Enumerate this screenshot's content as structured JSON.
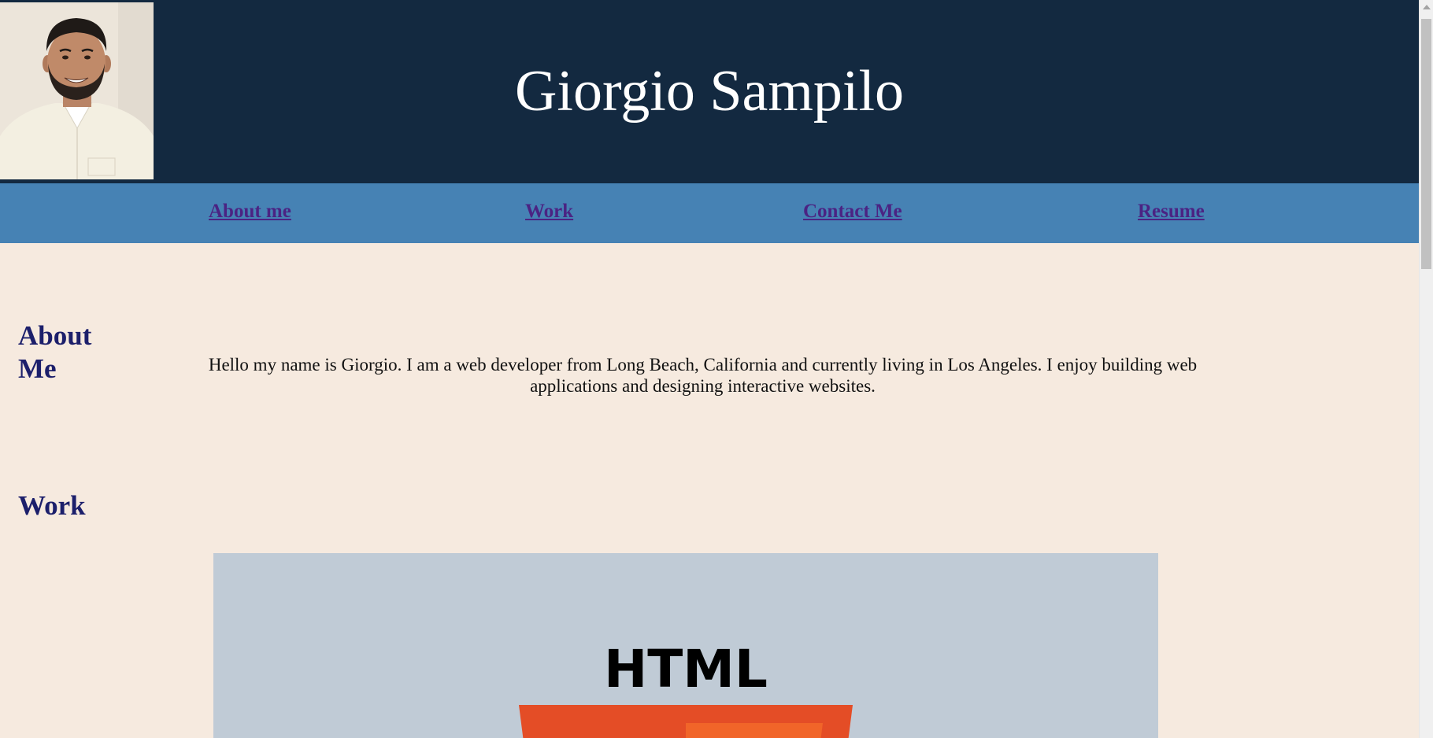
{
  "header": {
    "title": "Giorgio Sampilo",
    "photo_icon": "profile-photo",
    "background": "#132940"
  },
  "nav": {
    "background": "#4682b4",
    "link_color": "#4b2383",
    "items": [
      {
        "label": "About me"
      },
      {
        "label": "Work"
      },
      {
        "label": "Contact Me"
      },
      {
        "label": "Resume"
      }
    ]
  },
  "about": {
    "heading_line1": "About",
    "heading_line2": "Me",
    "text": "Hello my name is Giorgio. I am a web developer from Long Beach, California and currently living in Los Angeles. I enjoy building web applications and designing interactive websites."
  },
  "work": {
    "heading": "Work",
    "image_label": "HTML",
    "image_icon": "html5-logo"
  },
  "colors": {
    "page_background": "#f6eadf",
    "heading_color": "#1c1f6b",
    "html5_orange": "#e44d26",
    "html5_light_orange": "#f16529"
  }
}
